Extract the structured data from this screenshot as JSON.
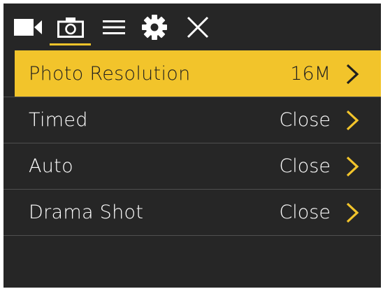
{
  "theme": {
    "accent": "#f2c42b",
    "background": "#262626",
    "text": "#ffffff",
    "selected_text": "#1f1f1f"
  },
  "tabs": [
    {
      "icon": "video-camera-icon",
      "active": false
    },
    {
      "icon": "photo-camera-icon",
      "active": true
    },
    {
      "icon": "menu-list-icon",
      "active": false
    },
    {
      "icon": "settings-gear-icon",
      "active": false
    },
    {
      "icon": "close-icon",
      "active": false
    }
  ],
  "menu": {
    "items": [
      {
        "label": "Photo Resolution",
        "value": "16M",
        "selected": true
      },
      {
        "label": "Timed",
        "value": "Close",
        "selected": false
      },
      {
        "label": "Auto",
        "value": "Close",
        "selected": false
      },
      {
        "label": "Drama Shot",
        "value": "Close",
        "selected": false
      }
    ]
  }
}
